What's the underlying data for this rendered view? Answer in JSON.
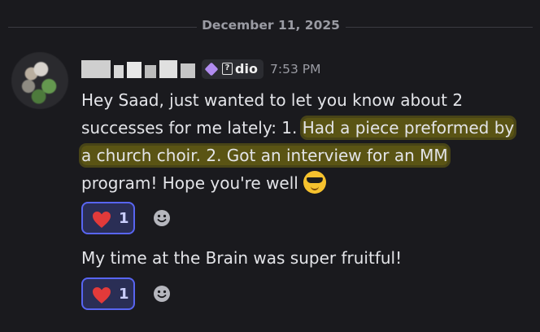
{
  "divider": {
    "date": "December 11, 2025"
  },
  "message": {
    "tag_text": "dio",
    "tag_icon": "server-tag-gem-icon",
    "time": "7:53 PM",
    "line1": "Hey Saad, just wanted to let you know about 2",
    "line2_plain": "successes for me lately: 1. ",
    "line2_highlight": "Had a piece preformed by",
    "line3_highlight": "a church choir. 2. Got an interview for an MM",
    "line4": "program! Hope you're well ",
    "end_emoji": "sunglasses-emoji-icon",
    "highlight_color": "#706812"
  },
  "reactions": [
    {
      "emoji": "heart-icon",
      "count": "1"
    },
    {
      "emoji": "heart-icon",
      "count": "1"
    }
  ],
  "message2": {
    "text": "My time at the Brain was super fruitful!"
  },
  "colors": {
    "accent": "#5865f2",
    "background": "#1a1a1e"
  }
}
